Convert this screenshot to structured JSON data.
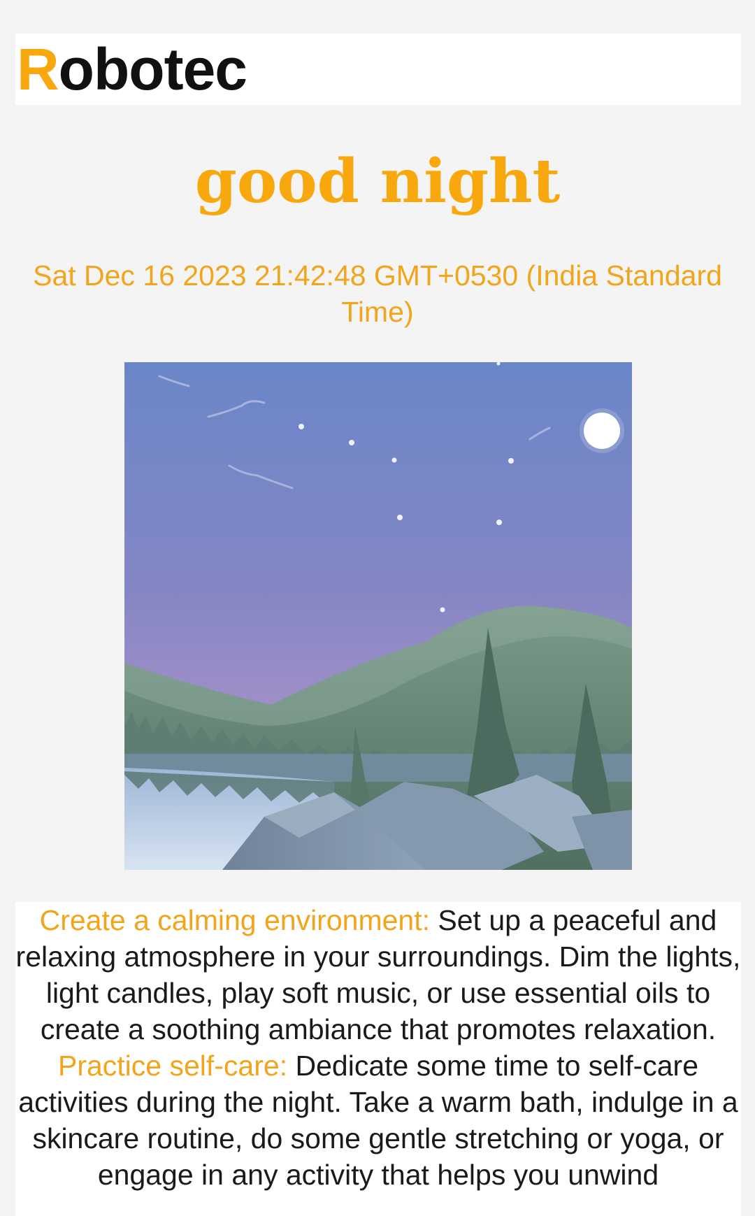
{
  "header": {
    "brand_first_letter": "R",
    "brand_rest": "obotec"
  },
  "main": {
    "greeting": "good night",
    "datetime": "Sat Dec 16 2023 21:42:48 GMT+0530 (India Standard Time)"
  },
  "scene": {
    "icon": "night-landscape-illustration",
    "sky_top_color": "#6a86c8",
    "sky_bottom_color": "#a892c9",
    "moon_color": "#ffffff"
  },
  "tips": [
    {
      "heading": "Create a calming environment:",
      "text": "Set up a peaceful and relaxing atmosphere in your surroundings. Dim the lights, light candles, play soft music, or use essential oils to create a soothing ambiance that promotes relaxation."
    },
    {
      "heading": "Practice self-care:",
      "text": "Dedicate some time to self-care activities during the night. Take a warm bath, indulge in a skincare routine, do some gentle stretching or yoga, or engage in any activity that helps you unwind"
    }
  ],
  "colors": {
    "accent": "#f8a80d",
    "background": "#f4f4f4",
    "text": "#1a1a1a"
  }
}
